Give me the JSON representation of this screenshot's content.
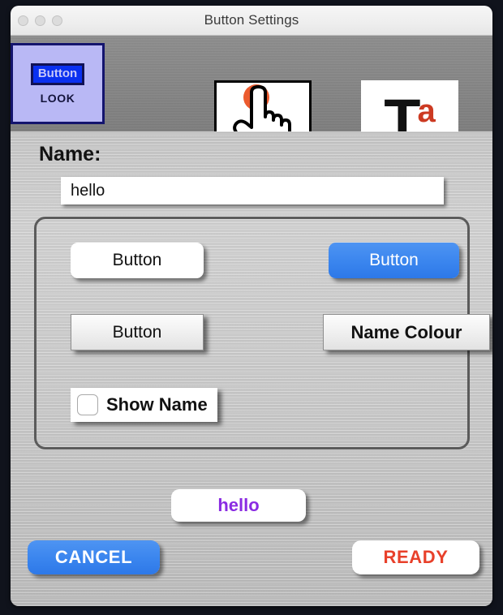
{
  "window": {
    "title": "Button Settings",
    "traffic_lights": [
      "close-button",
      "minimize-button",
      "zoom-button"
    ]
  },
  "toolbar": {
    "tabs": [
      {
        "id": "look",
        "icon": "button-look-icon",
        "chip_label": "Button",
        "label": "LOOK",
        "selected": true
      },
      {
        "id": "action",
        "icon": "pointing-hand-tap-icon",
        "label": "",
        "selected": false
      },
      {
        "id": "text",
        "icon": "text-typography-icon",
        "glyph_main": "T",
        "glyph_sup": "a",
        "label": "",
        "selected": false
      }
    ]
  },
  "main": {
    "name_label": "Name:",
    "name_value": "hello",
    "name_placeholder": "",
    "group": {
      "button_shape_label": "Button",
      "button_colour_label": "Button",
      "font_label": "Button",
      "name_colour_label": "Name Colour",
      "show_name_label": "Show Name",
      "show_name_checked": false
    },
    "preview_label": "hello"
  },
  "footer": {
    "cancel_label": "CANCEL",
    "ready_label": "READY"
  },
  "colors": {
    "accent_blue": "#3a85ee",
    "ready_red": "#e8402a",
    "preview_purple": "#8a2be2",
    "tab_selected_bg": "#b9b8f5",
    "tab_selected_border": "#14146e",
    "chip_blue": "#0a30f0",
    "text_icon_red": "#cc3a22",
    "window_bg": "#c4c4c4"
  }
}
